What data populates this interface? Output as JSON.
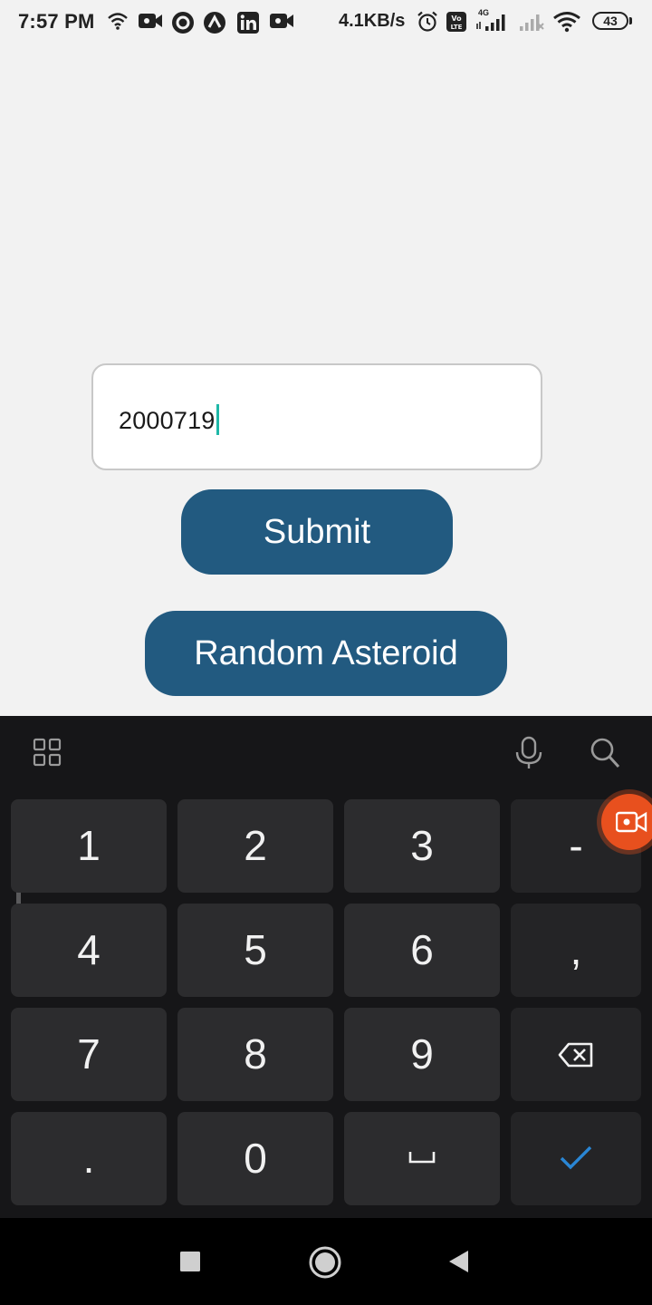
{
  "status_bar": {
    "time": "7:57 PM",
    "network_speed": "4.1KB/s",
    "battery_level": "43",
    "network_type": "4G",
    "icons": [
      "wifi-icon",
      "video-camera-icon",
      "circle-app-icon",
      "arc-app-icon",
      "linkedin-icon",
      "video-camera-icon",
      "alarm-icon",
      "volte-icon",
      "signal-icon",
      "signal-icon",
      "wifi-icon",
      "battery-icon"
    ]
  },
  "form": {
    "asteroid_id_value": "2000719",
    "submit_label": "Submit",
    "random_label": "Random Asteroid"
  },
  "colors": {
    "accent": "#225a80",
    "caret": "#1fb8a8",
    "background": "#f2f2f2",
    "keyboard_bg": "#161618",
    "confirm_check": "#2a86d4"
  },
  "keyboard": {
    "toolbar_icons": [
      "grid-icon",
      "microphone-icon",
      "search-icon"
    ],
    "keys": {
      "k1": "1",
      "k2": "2",
      "k3": "3",
      "dash": "-",
      "k4": "4",
      "k5": "5",
      "k6": "6",
      "comma": ",",
      "k7": "7",
      "k8": "8",
      "k9": "9",
      "period": ".",
      "k0": "0"
    },
    "special_keys": [
      "backspace-icon",
      "space-icon",
      "checkmark-icon"
    ]
  },
  "nav_bar": {
    "icons": [
      "recents-square-icon",
      "home-circle-icon",
      "back-triangle-icon"
    ]
  }
}
